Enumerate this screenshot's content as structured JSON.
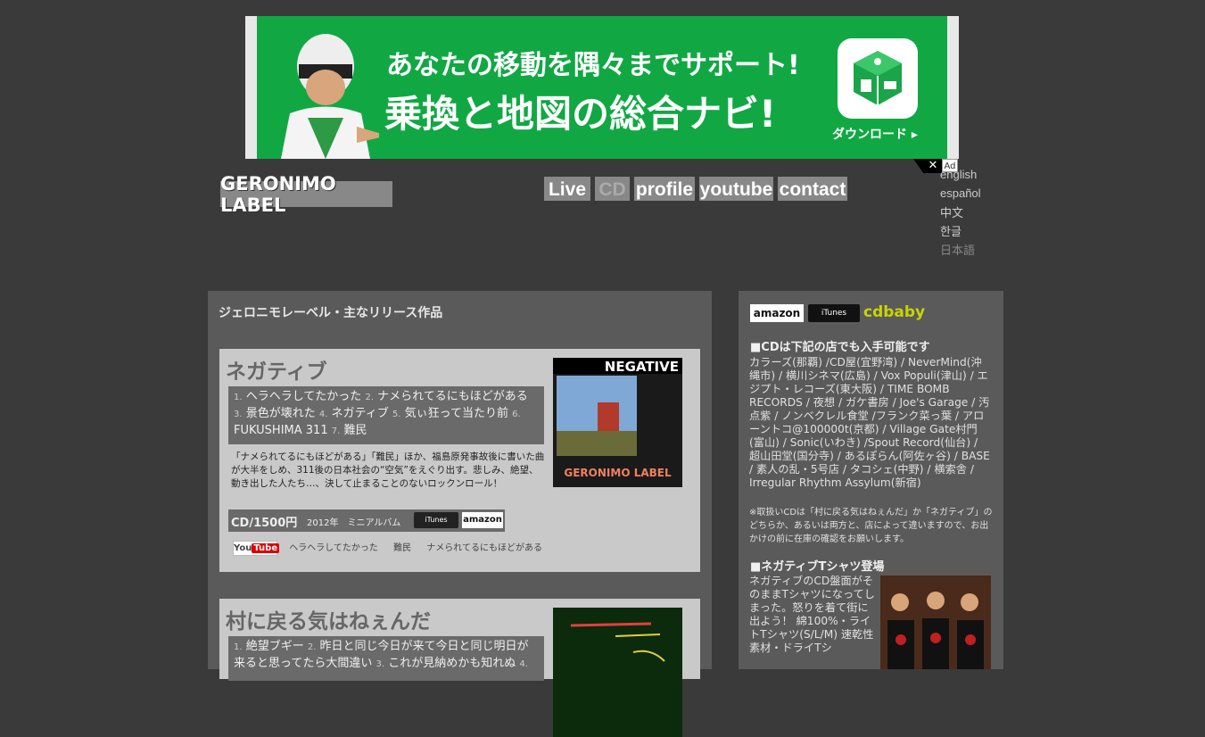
{
  "ad": {
    "line1": "あなたの移動を隅々までサポート!",
    "line2": "乗換と地図の総合ナビ!",
    "download": "ダウンロード ▸",
    "close": "✕",
    "label": "Ad"
  },
  "header": {
    "logo": "GERONIMO LABEL",
    "nav": [
      "Live",
      "CD",
      "profile",
      "youtube",
      "contact"
    ],
    "languages": [
      "english",
      "español",
      "中文",
      "한글",
      "日本語"
    ]
  },
  "main": {
    "title": "ジェロニモレーベル・主なリリース作品",
    "releases": [
      {
        "title": "ネガティブ",
        "tracks": [
          {
            "n": "1.",
            "t": "ヘラヘラしてたかった"
          },
          {
            "n": "2.",
            "t": "ナメられてるにもほどがある"
          },
          {
            "n": "3.",
            "t": "景色が壊れた"
          },
          {
            "n": "4.",
            "t": "ネガティブ"
          },
          {
            "n": "5.",
            "t": "気ぃ狂って当たり前"
          },
          {
            "n": "6.",
            "t": "FUKUSHIMA 311"
          },
          {
            "n": "7.",
            "t": "難民"
          }
        ],
        "description": "「ナメられてるにもほどがある」「難民」ほか、福島原発事故後に書いた曲が大半をしめ、311後の日本社会の“空気”をえぐり出す。悲しみ、絶望、動き出した人たち…、決して止まることのないロックンロール！",
        "price": "CD/1500円",
        "meta": "2012年　ミニアルバム",
        "itunes": "iTunes",
        "amazon": "amazon",
        "youtube_logo_a": "You",
        "youtube_logo_b": "Tube",
        "videos": [
          "ヘラヘラしてたかった",
          "難民",
          "ナメられてるにもほどがある"
        ],
        "cover_title": "NEGATIVE",
        "cover_logo": "GERONIMO LABEL"
      },
      {
        "title": "村に戻る気はねぇんだ",
        "tracks": [
          {
            "n": "1.",
            "t": "絶望ブギー"
          },
          {
            "n": "2.",
            "t": "昨日と同じ今日が来て今日と同じ明日が来ると思ってたら大間違い"
          },
          {
            "n": "3.",
            "t": "これが見納めかも知れぬ"
          },
          {
            "n": "4.",
            "t": ""
          }
        ]
      }
    ]
  },
  "sidebar": {
    "stores": {
      "amazon": "amazon",
      "itunes": "iTunes",
      "cdbaby": "cdbaby"
    },
    "shops_heading": "■CDは下記の店でも入手可能です",
    "shops": "カラーズ(那覇) /CD屋(宜野湾) / NeverMind(沖縄市) / 横川シネマ(広島) / Vox Populi(津山) / エジプト・レコーズ(東大阪) / TIME BOMB RECORDS / 夜想 / ガケ書房 / Joe's Garage / 汚点紫 / ノンベクレル食堂 /フランク菜っ葉 / アローントコ@100000t(京都) / Village Gate村門(富山) / Sonic(いわき) /Spout Record(仙台) / 超山田堂(国分寺) / あるぽらん(阿佐ヶ谷) / BASE / 素人の乱・5号店 / タコシェ(中野) / 横索舎 / Irregular Rhythm Assylum(新宿)",
    "note": "※取扱いCDは「村に戻る気はねぇんだ」か「ネガティブ」のどちらか、あるいは両方と、店によって違いますので、お出かけの前に在庫の確認をお願いします。",
    "tshirt_heading": "■ネガティブTシャツ登場",
    "tshirt_text": "ネガティブのCD盤面がそのままTシャツになってしまった。怒りを着て街に出よう！ 綿100%・ライトTシャツ(S/L/M) 速乾性素材・ドライTシ"
  }
}
